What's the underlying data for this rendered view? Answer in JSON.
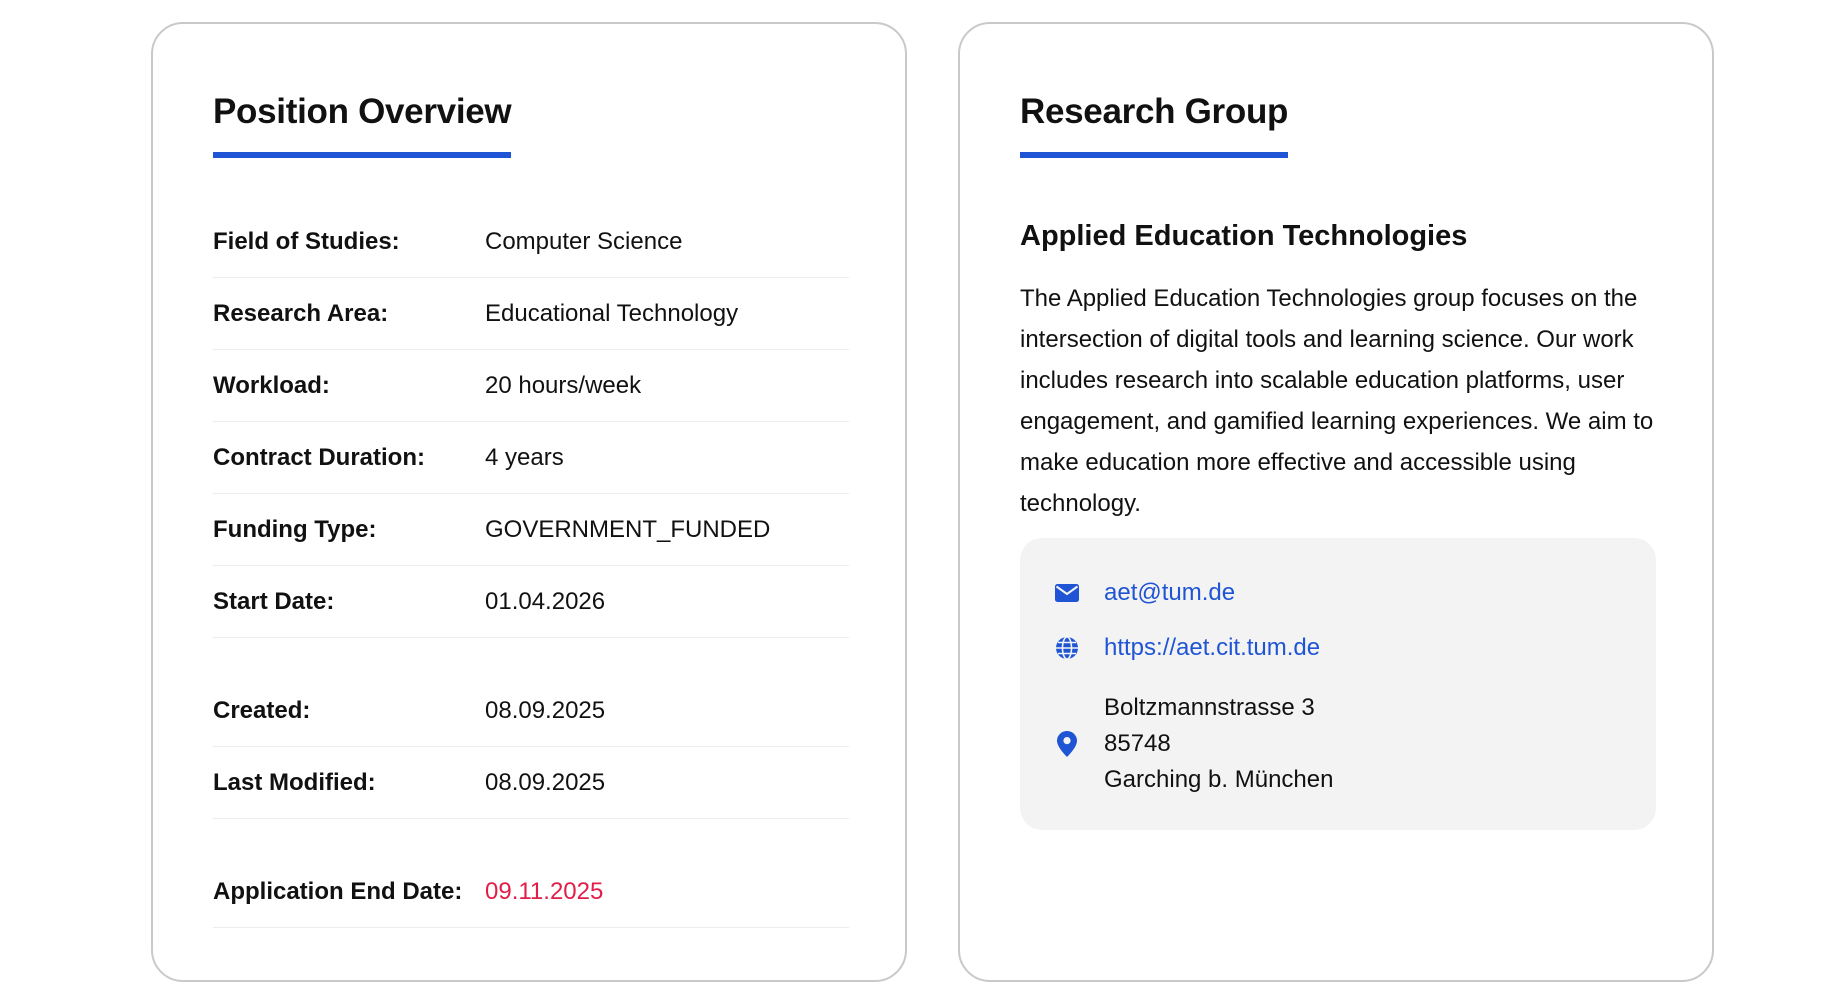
{
  "position_overview": {
    "title": "Position Overview",
    "rows_main": [
      {
        "label": "Field of Studies:",
        "value": "Computer Science"
      },
      {
        "label": "Research Area:",
        "value": "Educational Technology"
      },
      {
        "label": "Workload:",
        "value": "20 hours/week"
      },
      {
        "label": "Contract Duration:",
        "value": "4 years"
      },
      {
        "label": "Funding Type:",
        "value": "GOVERNMENT_FUNDED"
      },
      {
        "label": "Start Date:",
        "value": "01.04.2026"
      }
    ],
    "rows_meta": [
      {
        "label": "Created:",
        "value": "08.09.2025"
      },
      {
        "label": "Last Modified:",
        "value": "08.09.2025"
      }
    ],
    "deadline": {
      "label": "Application End Date:",
      "value": "09.11.2025",
      "color": "#e11d48"
    }
  },
  "research_group": {
    "title": "Research Group",
    "name": "Applied Education Technologies",
    "description": "The Applied Education Technologies group focuses on the intersection of digital tools and learning science. Our work includes research into scalable education platforms, user engagement, and gamified learning experiences. We aim to make education more effective and accessible using technology.",
    "contact": {
      "email": "aet@tum.de",
      "website": "https://aet.cit.tum.de",
      "address": {
        "street": "Boltzmannstrasse 3",
        "postal_code": "85748",
        "city": "Garching b. München"
      },
      "icons": {
        "email": "envelope-icon",
        "website": "globe-icon",
        "address": "map-pin-icon"
      }
    }
  },
  "colors": {
    "accent": "#1f55d4",
    "deadline": "#e11d48",
    "card_border": "#c9c9c9",
    "contact_bg": "#f3f3f3"
  }
}
